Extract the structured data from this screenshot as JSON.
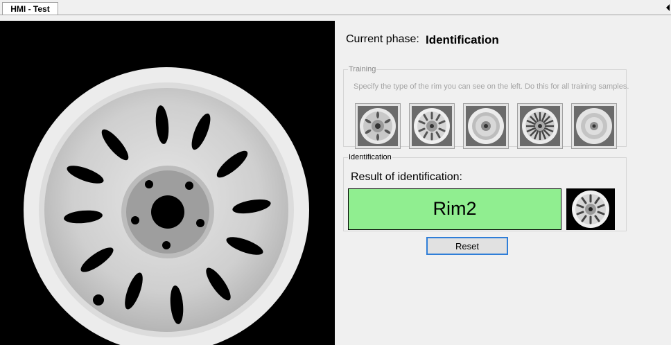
{
  "tabs": [
    {
      "label": "HMI - Test",
      "active": true
    }
  ],
  "phase": {
    "label": "Current phase:",
    "value": "Identification"
  },
  "training": {
    "legend": "Training",
    "hint": "Specify the type of the rim you can see on the left. Do this for all training samples.",
    "samples": [
      {
        "icon": "rim1-thumbnail-icon"
      },
      {
        "icon": "rim2-thumbnail-icon"
      },
      {
        "icon": "rim3-thumbnail-icon"
      },
      {
        "icon": "rim4-thumbnail-icon"
      },
      {
        "icon": "rim5-thumbnail-icon"
      }
    ]
  },
  "identification": {
    "legend": "Identification",
    "label": "Result of identification:",
    "result": "Rim2",
    "result_color": "#90ee90",
    "result_icon": "rim2-result-icon"
  },
  "reset": {
    "label": "Reset"
  },
  "colors": {
    "accent": "#2f7ed8",
    "camera_background": "#000000"
  }
}
